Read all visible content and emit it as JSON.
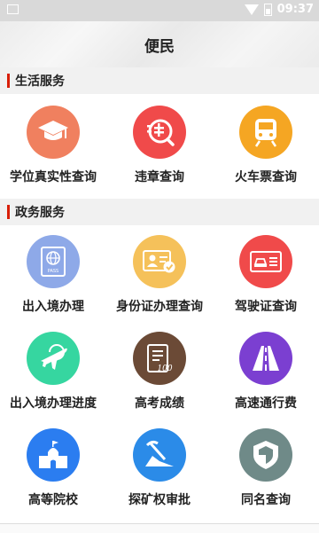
{
  "status": {
    "time": "09:37"
  },
  "header": {
    "title": "便民"
  },
  "sections": [
    {
      "title": "生活服务",
      "items": [
        {
          "label": "学位真实性查询",
          "icon": "graduation-cap-icon",
          "color": "#f0805f"
        },
        {
          "label": "违章查询",
          "icon": "traffic-violation-icon",
          "color": "#f04a4a"
        },
        {
          "label": "火车票查询",
          "icon": "train-icon",
          "color": "#f5a623"
        }
      ]
    },
    {
      "title": "政务服务",
      "items": [
        {
          "label": "出入境办理",
          "icon": "passport-icon",
          "color": "#8ea9e8",
          "icon_text": "PASS"
        },
        {
          "label": "身份证办理查询",
          "icon": "id-card-icon",
          "color": "#f5c15a"
        },
        {
          "label": "驾驶证查询",
          "icon": "driver-license-icon",
          "color": "#f04a4a"
        },
        {
          "label": "出入境办理进度",
          "icon": "airplane-icon",
          "color": "#36d6a0"
        },
        {
          "label": "高考成绩",
          "icon": "exam-score-icon",
          "color": "#6b4a36",
          "icon_text": "100"
        },
        {
          "label": "高速通行费",
          "icon": "highway-icon",
          "color": "#7b3fd1"
        },
        {
          "label": "高等院校",
          "icon": "university-icon",
          "color": "#2b7df0"
        },
        {
          "label": "探矿权审批",
          "icon": "mining-icon",
          "color": "#2b8be8"
        },
        {
          "label": "同名查询",
          "icon": "same-name-icon",
          "color": "#6f8a88"
        }
      ]
    }
  ]
}
